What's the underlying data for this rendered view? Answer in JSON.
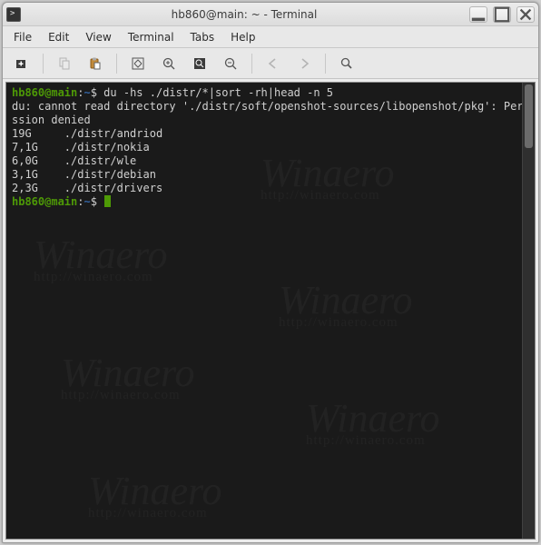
{
  "window": {
    "title": "hb860@main: ~ - Terminal"
  },
  "menubar": [
    {
      "label": "File"
    },
    {
      "label": "Edit"
    },
    {
      "label": "View"
    },
    {
      "label": "Terminal"
    },
    {
      "label": "Tabs"
    },
    {
      "label": "Help"
    }
  ],
  "toolbar": {
    "new_tab": "new-tab-icon",
    "copy": "copy-icon",
    "paste": "paste-icon",
    "fullscreen": "fullscreen-icon",
    "zoom_in": "zoom-in-icon",
    "zoom_fit": "zoom-fit-icon",
    "zoom_out": "zoom-out-icon",
    "prev": "prev-icon",
    "next": "next-icon",
    "search": "search-icon"
  },
  "terminal": {
    "prompt_user": "hb860@main",
    "prompt_path": "~",
    "command": "du -hs ./distr/*|sort -rh|head -n 5",
    "error_line": "du: cannot read directory './distr/soft/openshot-sources/libopenshot/pkg': Permission denied",
    "results": [
      {
        "size": "19G",
        "path": "./distr/andriod"
      },
      {
        "size": "7,1G",
        "path": "./distr/nokia"
      },
      {
        "size": "6,0G",
        "path": "./distr/wle"
      },
      {
        "size": "3,1G",
        "path": "./distr/debian"
      },
      {
        "size": "2,3G",
        "path": "./distr/drivers"
      }
    ]
  },
  "watermark": {
    "big": "Winaero",
    "url": "http://winaero.com"
  }
}
